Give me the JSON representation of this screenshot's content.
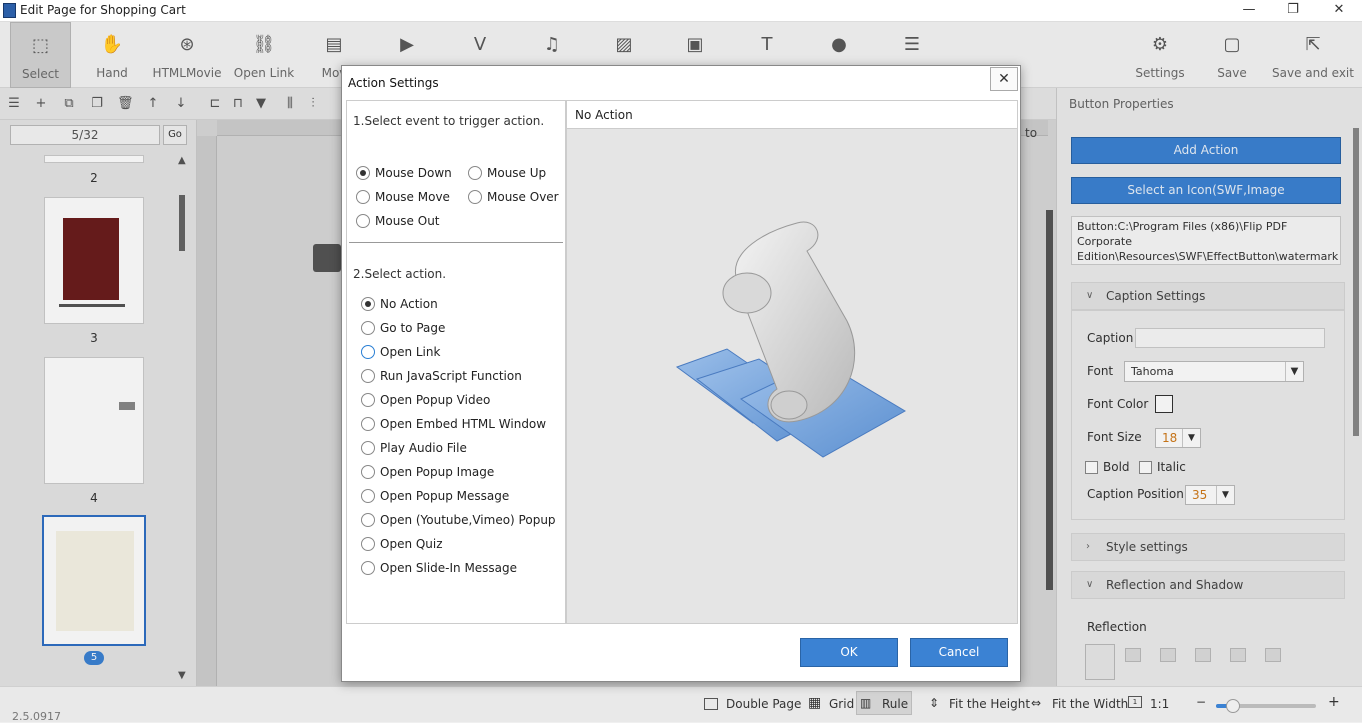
{
  "window": {
    "title": "Edit Page for Shopping Cart",
    "controls": {
      "minimize": "—",
      "restore": "❐",
      "close": "✕"
    }
  },
  "toolbar": {
    "items": [
      {
        "label": "Select",
        "icon": "select-cursor-icon",
        "glyph": "⬚"
      },
      {
        "label": "Hand",
        "icon": "hand-icon",
        "glyph": "✋"
      },
      {
        "label": "HTMLMovie",
        "icon": "film-reel-icon",
        "glyph": "⊛"
      },
      {
        "label": "Open Link",
        "icon": "link-icon",
        "glyph": "⛓"
      },
      {
        "label": "Mov",
        "icon": "movie-icon",
        "glyph": "▤"
      },
      {
        "label": "",
        "icon": "youtube-icon",
        "glyph": "▶"
      },
      {
        "label": "",
        "icon": "vimeo-icon",
        "glyph": "V"
      },
      {
        "label": "",
        "icon": "music-icon",
        "glyph": "♫"
      },
      {
        "label": "",
        "icon": "image-icon",
        "glyph": "▨"
      },
      {
        "label": "",
        "icon": "gallery-icon",
        "glyph": "▣"
      },
      {
        "label": "",
        "icon": "text-icon",
        "glyph": "T"
      },
      {
        "label": "",
        "icon": "flash-icon",
        "glyph": "●"
      },
      {
        "label": "",
        "icon": "align-icon",
        "glyph": "☰"
      }
    ],
    "right": [
      {
        "label": "Settings",
        "icon": "gear-icon",
        "glyph": "⚙"
      },
      {
        "label": "Save",
        "icon": "save-icon",
        "glyph": "▢"
      },
      {
        "label": "Save and exit",
        "icon": "save-exit-icon",
        "glyph": "⇱"
      }
    ]
  },
  "pages": {
    "current": "5/32",
    "go": "Go",
    "numbers": [
      "2",
      "3",
      "4",
      "5"
    ],
    "selected": "5"
  },
  "canvas": {
    "partial_label": "to"
  },
  "dialog": {
    "title": "Action Settings",
    "close": "✕",
    "step1": "1.Select event to trigger action.",
    "events": [
      "Mouse Down",
      "Mouse Up",
      "Mouse Move",
      "Mouse Over",
      "Mouse Out"
    ],
    "selected_event": "Mouse Down",
    "step2": "2.Select action.",
    "actions": [
      "No Action",
      "Go to Page",
      "Open Link",
      "Run JavaScript Function",
      "Open Popup Video",
      "Open Embed HTML Window",
      "Play Audio File",
      "Open Popup Image",
      "Open Popup Message",
      "Open (Youtube,Vimeo) Popup",
      "Open Quiz",
      "Open Slide-In Message"
    ],
    "selected_action": "No Action",
    "hovered_action": "Open Link",
    "preview_title": "No Action",
    "ok": "OK",
    "cancel": "Cancel"
  },
  "properties": {
    "title": "Button Properties",
    "add_action": "Add Action",
    "select_icon": "Select an Icon(SWF,Image",
    "path": "Button:C:\\Program Files (x86)\\Flip PDF Corporate Edition\\Resources\\SWF\\EffectButton\\watermark",
    "caption_settings": "Caption Settings",
    "caption_label": "Caption",
    "caption_value": "",
    "font_label": "Font",
    "font_value": "Tahoma",
    "font_color_label": "Font Color",
    "font_size_label": "Font Size",
    "font_size_value": "18",
    "bold": "Bold",
    "italic": "Italic",
    "caption_position_label": "Caption Position",
    "caption_position_value": "35",
    "style_settings": "Style settings",
    "reflection_shadow": "Reflection and Shadow",
    "reflection": "Reflection"
  },
  "status": {
    "version": "2.5.0917",
    "double_page": "Double Page",
    "grid": "Grid",
    "rule": "Rule",
    "fit_height": "Fit the Height",
    "fit_width": "Fit the Width",
    "zoom": "1:1",
    "zoom_level": 0.08
  },
  "colors": {
    "accent": "#3b82d3",
    "accent_border": "#2a64a6",
    "font_size_text": "#d07a1a"
  }
}
